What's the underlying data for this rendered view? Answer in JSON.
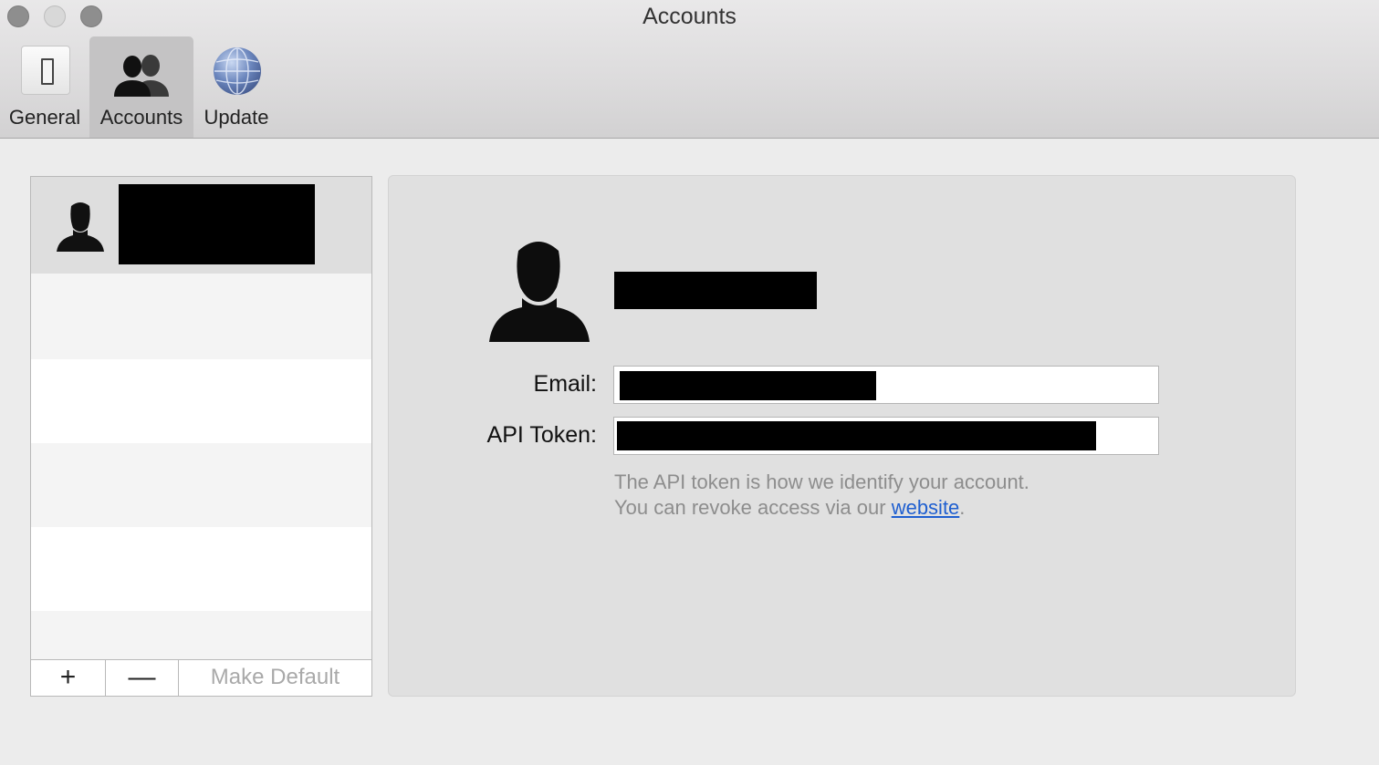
{
  "window": {
    "title": "Accounts"
  },
  "toolbar": {
    "items": [
      {
        "label": "General",
        "icon": "switch-icon",
        "selected": false
      },
      {
        "label": "Accounts",
        "icon": "accounts-icon",
        "selected": true
      },
      {
        "label": "Update",
        "icon": "globe-icon",
        "selected": false
      }
    ]
  },
  "accounts_list": {
    "footer": {
      "add_label": "+",
      "remove_label": "—",
      "make_default_label": "Make Default"
    }
  },
  "details": {
    "email_label": "Email:",
    "api_token_label": "API Token:",
    "hint_line1": "The API token is how we identify your account.",
    "hint_line2_prefix": "You can revoke access via our ",
    "hint_link": "website",
    "hint_suffix": "."
  },
  "colors": {
    "link": "#1f5fd0",
    "selected_row": "#dedede",
    "panel": "#e0e0e0"
  }
}
